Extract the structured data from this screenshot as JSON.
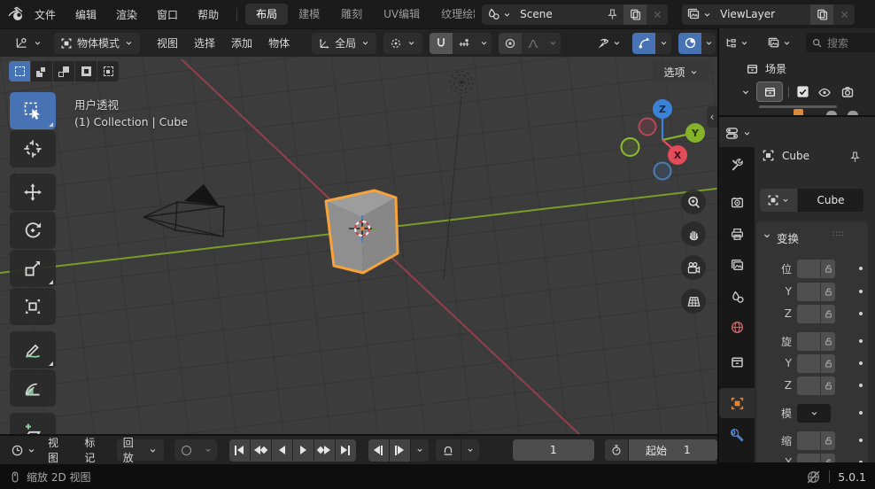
{
  "topbar": {
    "menus": [
      "文件",
      "编辑",
      "渲染",
      "窗口",
      "帮助"
    ],
    "tabs": [
      "布局",
      "建模",
      "雕刻",
      "UV编辑",
      "纹理绘制"
    ],
    "scene_value": "Scene",
    "view_layer_value": "ViewLayer"
  },
  "viewport_header": {
    "mode": "物体模式",
    "menus": [
      "视图",
      "选择",
      "添加",
      "物体"
    ],
    "orientation": "全局"
  },
  "viewport": {
    "options": "选项",
    "view_label": "用户透视",
    "context_label": "(1) Collection | Cube",
    "axis": {
      "x": "X",
      "y": "Y",
      "z": "Z"
    }
  },
  "outliner": {
    "scene_label": "场景",
    "search_placeholder": "搜索"
  },
  "properties": {
    "breadcrumb_object": "Cube",
    "name_value": "Cube",
    "transform_title": "变换",
    "rows": [
      "位",
      "Y",
      "Z",
      "旋",
      "Y",
      "Z",
      "模",
      "缩",
      "Y"
    ]
  },
  "timeline": {
    "menus": [
      "视图",
      "标记",
      "回放"
    ],
    "current_frame": "1",
    "start_label": "起始"
  },
  "statusbar": {
    "hint": "缩放 2D 视图",
    "version": "5.0.1"
  },
  "colors": {
    "accent_blue": "#4772b3",
    "selection_orange": "#f7a33c",
    "axis_x": "#a34052",
    "axis_y": "#7a9c28",
    "axis_z": "#3b83d8",
    "object_tab_orange": "#e0863a",
    "modifier_tab_blue": "#5b8bd4",
    "world_tab_red": "#c56767"
  }
}
